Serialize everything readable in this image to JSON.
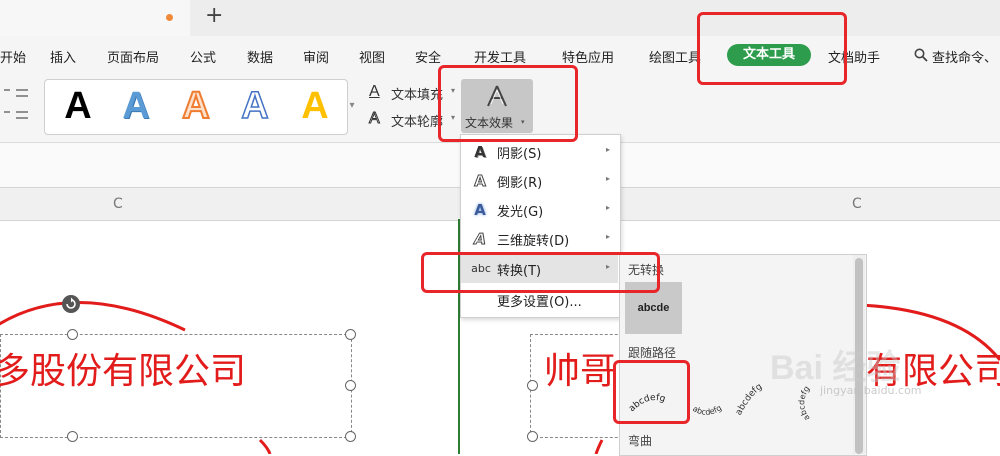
{
  "tabbar": {
    "new_tab_symbol": "+"
  },
  "menu": {
    "items": [
      "开始",
      "插入",
      "页面布局",
      "公式",
      "数据",
      "审阅",
      "视图",
      "安全",
      "开发工具",
      "特色应用",
      "绘图工具",
      "文本工具",
      "文档助手"
    ],
    "active": "文本工具",
    "search_label": "查找命令、"
  },
  "ribbon": {
    "style_samples": [
      {
        "letter": "A",
        "fill": "#000000",
        "stroke": "none"
      },
      {
        "letter": "A",
        "fill": "#5b9bd5",
        "stroke": "none"
      },
      {
        "letter": "A",
        "fill": "#ffffff",
        "stroke": "#ee7d31"
      },
      {
        "letter": "A",
        "fill": "#ffffff",
        "stroke": "#4472c4"
      },
      {
        "letter": "A",
        "fill": "#ffc000",
        "stroke": "none"
      }
    ],
    "text_fill_label": "文本填充",
    "text_outline_label": "文本轮廓",
    "text_effect_label": "文本效果"
  },
  "columns": {
    "left": "C",
    "right": "C"
  },
  "dropdown": {
    "items": [
      {
        "label": "阴影(S)",
        "has_submenu": true
      },
      {
        "label": "倒影(R)",
        "has_submenu": true
      },
      {
        "label": "发光(G)",
        "has_submenu": true
      },
      {
        "label": "三维旋转(D)",
        "has_submenu": true
      },
      {
        "label": "转换(T)",
        "has_submenu": true,
        "icon_text": "abc"
      },
      {
        "label": "更多设置(O)...",
        "has_submenu": false
      }
    ]
  },
  "submenu": {
    "section_no_transform": "无转换",
    "no_transform_sample": "abcde",
    "section_follow_path": "跟随路径",
    "follow_path_sample": "abcdefg",
    "section_warp": "弯曲"
  },
  "stamp": {
    "left_text": "多股份有限公司",
    "right_text_a": "帅哥",
    "right_text_b": "有限公司",
    "color": "#e21b1b"
  },
  "watermark": {
    "brand": "Bai 经验",
    "url": "jingyan.baidu.com"
  },
  "colors": {
    "accent_green": "#2e9c4d",
    "highlight_red": "#e8262a"
  }
}
